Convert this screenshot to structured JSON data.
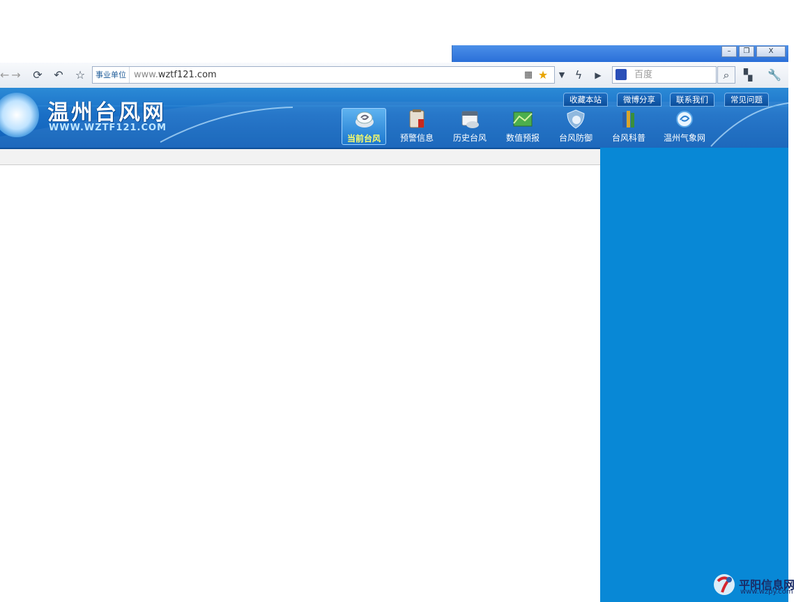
{
  "window": {
    "minimize_label": "–",
    "restore_label": "❐",
    "close_label": "X"
  },
  "browser": {
    "address_tag": "事业单位",
    "url_prefix": "www.",
    "url_rest": "wztf121.com",
    "search_placeholder": "百度",
    "icons": [
      "back-icon",
      "forward-icon",
      "refresh-icon",
      "undo-icon",
      "favorite-icon",
      "qr-icon",
      "star-icon",
      "dropdown-icon",
      "lightning-icon",
      "play-icon",
      "baidu-paw-icon",
      "search-icon",
      "apps-icon",
      "tools-icon"
    ]
  },
  "site": {
    "title": "温州台风网",
    "subtitle": "WWW.WZTF121.COM",
    "top_links": [
      "收藏本站",
      "微博分享",
      "联系我们",
      "常见问题"
    ],
    "nav": [
      {
        "label": "当前台风",
        "icon": "typhoon-icon",
        "active": true
      },
      {
        "label": "预警信息",
        "icon": "warning-board-icon",
        "active": false
      },
      {
        "label": "历史台风",
        "icon": "calendar-icon",
        "active": false
      },
      {
        "label": "数值预报",
        "icon": "map-icon",
        "active": false
      },
      {
        "label": "台风防御",
        "icon": "shield-icon",
        "active": false
      },
      {
        "label": "台风科普",
        "icon": "books-icon",
        "active": false
      },
      {
        "label": "温州气象网",
        "icon": "weather-icon",
        "active": false
      }
    ]
  },
  "watermark": {
    "title": "平阳信息网",
    "url": "www.wzpy.com"
  },
  "colors": {
    "banner": "#1a6fc6",
    "right_panel": "#0888d6",
    "active_nav_text": "#ffff66"
  }
}
